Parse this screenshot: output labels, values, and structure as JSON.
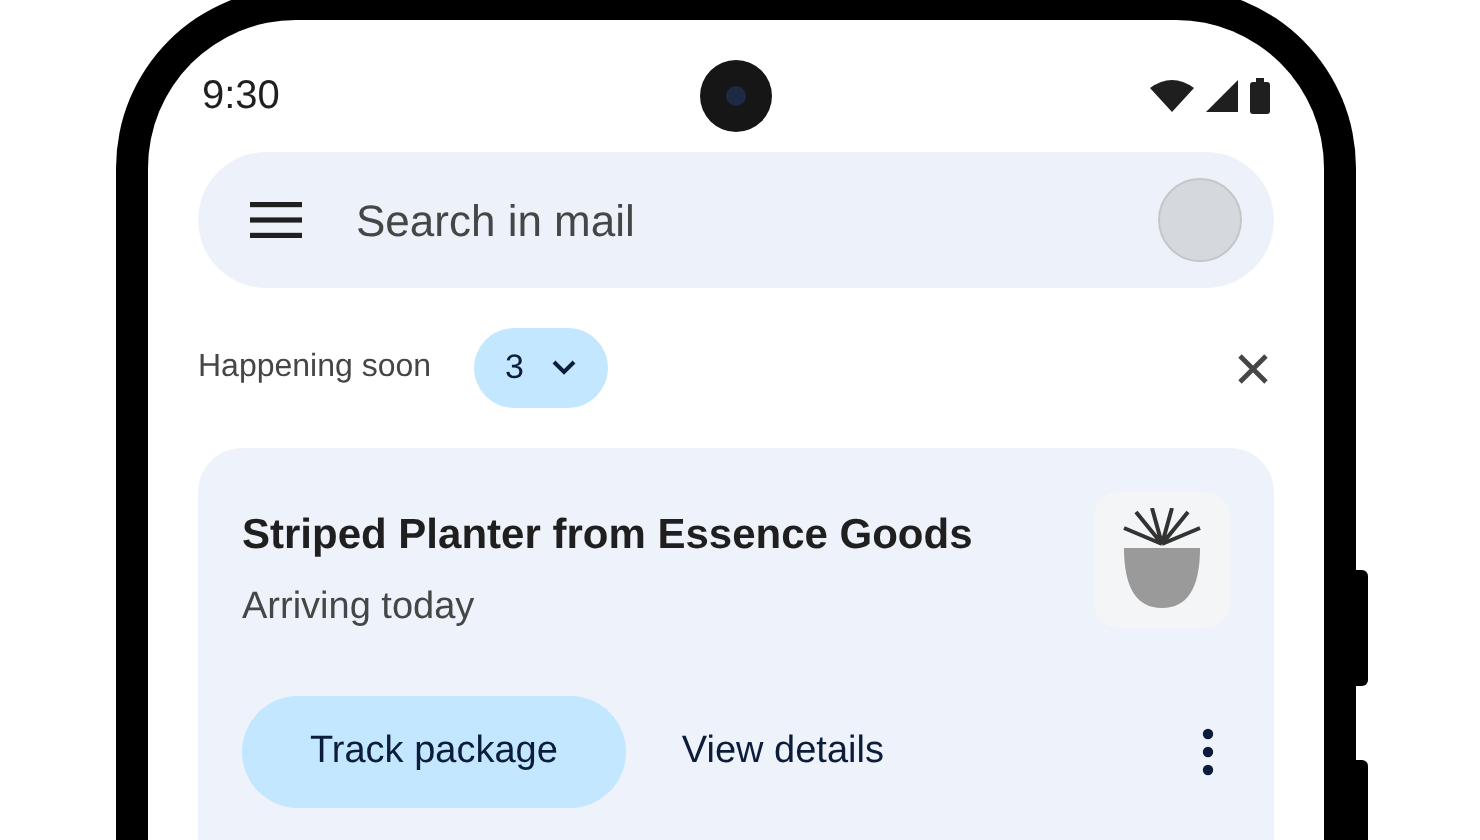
{
  "status_bar": {
    "time": "9:30"
  },
  "search": {
    "placeholder": "Search in mail"
  },
  "happening_soon": {
    "label": "Happening soon",
    "count": "3"
  },
  "card": {
    "title": "Striped Planter from Essence Goods",
    "subtitle": "Arriving today",
    "buttons": [
      {
        "label": "Track package",
        "kind": "filled"
      },
      {
        "label": "View details",
        "kind": "text"
      }
    ]
  }
}
